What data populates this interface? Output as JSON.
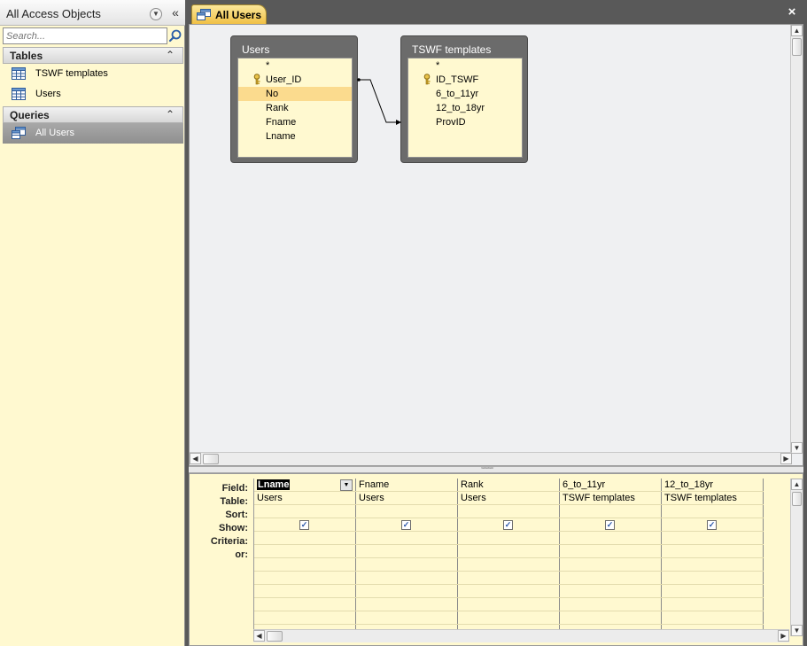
{
  "nav": {
    "title": "All Access Objects",
    "search_placeholder": "Search...",
    "groups": [
      {
        "label": "Tables",
        "items": [
          {
            "label": "TSWF templates"
          },
          {
            "label": "Users"
          }
        ]
      },
      {
        "label": "Queries",
        "items": [
          {
            "label": "All Users"
          }
        ]
      }
    ]
  },
  "document": {
    "tab_label": "All Users"
  },
  "design": {
    "tables": [
      {
        "title": "Users",
        "fields": [
          "*",
          "User_ID",
          "No",
          "Rank",
          "Fname",
          "Lname"
        ],
        "key_field": "User_ID",
        "selected_field": "No"
      },
      {
        "title": "TSWF templates",
        "fields": [
          "*",
          "ID_TSWF",
          "6_to_11yr",
          "12_to_18yr",
          "ProvID"
        ],
        "key_field": "ID_TSWF"
      }
    ]
  },
  "grid": {
    "row_labels": [
      "Field:",
      "Table:",
      "Sort:",
      "Show:",
      "Criteria:",
      "or:"
    ],
    "columns": [
      {
        "field": "Lname",
        "table": "Users",
        "show": true
      },
      {
        "field": "Fname",
        "table": "Users",
        "show": true
      },
      {
        "field": "Rank",
        "table": "Users",
        "show": true
      },
      {
        "field": "6_to_11yr",
        "table": "TSWF templates",
        "show": true
      },
      {
        "field": "12_to_18yr",
        "table": "TSWF templates",
        "show": true
      }
    ]
  },
  "colors": {
    "pane_background": "#fff9d0",
    "tab_accent": "#f0c046",
    "selected_field": "#fbdb8e"
  },
  "icons": {
    "table": "table-icon",
    "query": "query-icon",
    "key": "primary-key-icon",
    "search": "search-icon"
  }
}
